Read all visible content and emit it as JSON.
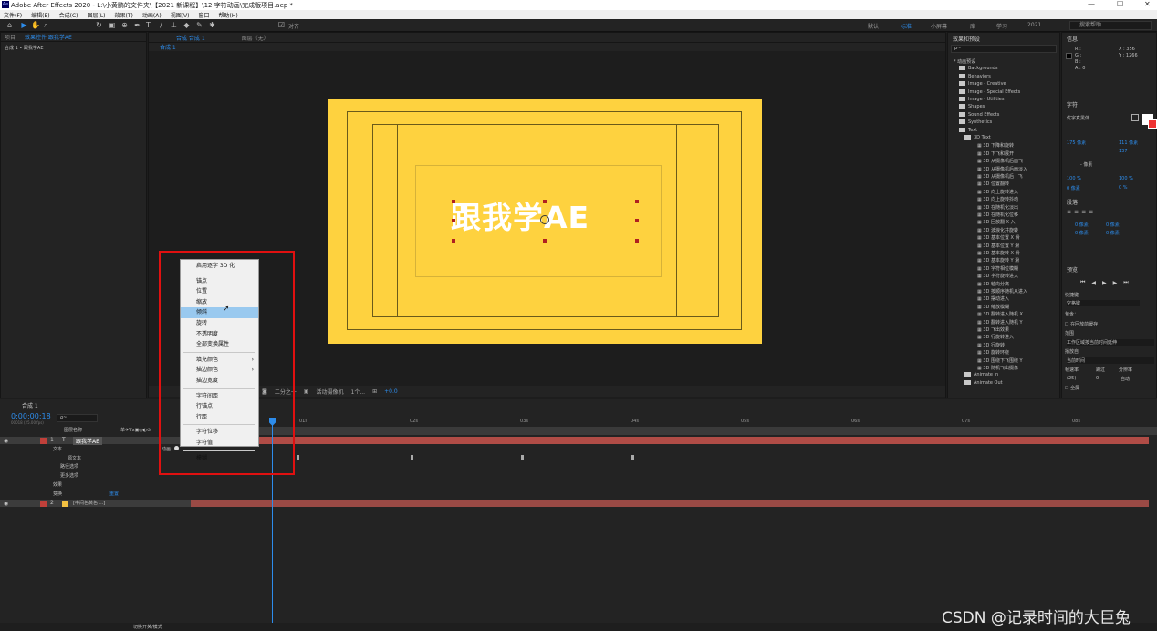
{
  "titlebar": {
    "title": "Adobe After Effects 2020 - L:\\小黄鹏的文件夹\\【2021 新课程】\\12 字符动画\\完成版项目.aep *",
    "minimize": "—",
    "maximize": "☐",
    "close": "✕"
  },
  "menu": [
    "文件(F)",
    "编辑(E)",
    "合成(C)",
    "图层(L)",
    "效果(T)",
    "动画(A)",
    "视图(V)",
    "窗口",
    "帮助(H)"
  ],
  "toolbar": {
    "snap_label": "对齐",
    "workspaces": [
      "默认",
      "标准",
      "小屏幕",
      "库",
      "学习",
      "2021"
    ],
    "active_workspace": "标准",
    "search_placeholder": "搜索帮助"
  },
  "left_panel": {
    "tabs": [
      "项目",
      "效果控件 跟我学AE"
    ],
    "breadcrumb": "合成 1 • 跟我学AE"
  },
  "comp_panel": {
    "tabs": [
      "合成 合成 1",
      "图层（无）"
    ],
    "sub_tab": "合成 1",
    "canvas_text": "跟我学AE",
    "viewer_bar": {
      "resolution": "二分之一",
      "camera": "活动摄像机",
      "views": "1个...",
      "exposure": "+0.0"
    }
  },
  "context_menu": {
    "items": [
      {
        "label": "启用逐字 3D 化",
        "sep_after": true
      },
      {
        "label": "锚点"
      },
      {
        "label": "位置"
      },
      {
        "label": "缩放"
      },
      {
        "label": "倾斜",
        "highlighted": true
      },
      {
        "label": "旋转"
      },
      {
        "label": "不透明度"
      },
      {
        "label": "全部变换属性",
        "sep_after": true
      },
      {
        "label": "填充颜色",
        "submenu": true
      },
      {
        "label": "描边颜色",
        "submenu": true
      },
      {
        "label": "描边宽度",
        "sep_after": true
      },
      {
        "label": "字符间距"
      },
      {
        "label": "行锚点"
      },
      {
        "label": "行距",
        "sep_after": true
      },
      {
        "label": "字符位移"
      },
      {
        "label": "字符值",
        "sep_after": true
      },
      {
        "label": "模糊"
      }
    ]
  },
  "effects_panel": {
    "title": "效果和预设",
    "search_placeholder": "ρ~",
    "items": [
      {
        "label": "* 动画预设",
        "level": 0
      },
      {
        "label": "Backgrounds",
        "level": 1,
        "folder": true
      },
      {
        "label": "Behaviors",
        "level": 1,
        "folder": true
      },
      {
        "label": "Image - Creative",
        "level": 1,
        "folder": true
      },
      {
        "label": "Image - Special Effects",
        "level": 1,
        "folder": true
      },
      {
        "label": "Image - Utilities",
        "level": 1,
        "folder": true
      },
      {
        "label": "Shapes",
        "level": 1,
        "folder": true
      },
      {
        "label": "Sound Effects",
        "level": 1,
        "folder": true
      },
      {
        "label": "Synthetics",
        "level": 1,
        "folder": true
      },
      {
        "label": "Text",
        "level": 1,
        "folder": true
      },
      {
        "label": "3D Text",
        "level": 2,
        "folder": true
      },
      {
        "label": "3D 下降和旋转",
        "level": 3
      },
      {
        "label": "3D 下飞和展开",
        "level": 3
      },
      {
        "label": "3D 从摄像机后面飞",
        "level": 3
      },
      {
        "label": "3D 从摄像机后面淡入",
        "level": 3
      },
      {
        "label": "3D 从摄像机后 I 飞",
        "level": 3
      },
      {
        "label": "3D 位置翻转",
        "level": 3
      },
      {
        "label": "3D 向上旋转进入",
        "level": 3
      },
      {
        "label": "3D 向上旋转抖动",
        "level": 3
      },
      {
        "label": "3D 在随机化淡出",
        "level": 3
      },
      {
        "label": "3D 在随机化位移",
        "level": 3
      },
      {
        "label": "3D 回放翻 X 入",
        "level": 3
      },
      {
        "label": "3D 波浪化并旋转",
        "level": 3
      },
      {
        "label": "3D 基本位置 X 滑",
        "level": 3
      },
      {
        "label": "3D 基本位置 Y 滑",
        "level": 3
      },
      {
        "label": "3D 基本旋转 X 滑",
        "level": 3
      },
      {
        "label": "3D 基本旋转 Y 滑",
        "level": 3
      },
      {
        "label": "3D 字符相位模糊",
        "level": 3
      },
      {
        "label": "3D 字符旋转进入",
        "level": 3
      },
      {
        "label": "3D 轴向分离",
        "level": 3
      },
      {
        "label": "3D 按顺序随机从进入",
        "level": 3
      },
      {
        "label": "3D 摆动进入",
        "level": 3
      },
      {
        "label": "3D 缩放模糊",
        "level": 3
      },
      {
        "label": "3D 翻转进入随机 X",
        "level": 3
      },
      {
        "label": "3D 翻转进入随机 Y",
        "level": 3
      },
      {
        "label": "3D 飞出效果",
        "level": 3
      },
      {
        "label": "3D 行旋转进入",
        "level": 3
      },
      {
        "label": "3D 行旋转",
        "level": 3
      },
      {
        "label": "3D 旋转环绕",
        "level": 3
      },
      {
        "label": "3D 围绕下飞围绕 Y",
        "level": 3
      },
      {
        "label": "3D 随机飞出摄像",
        "level": 3
      },
      {
        "label": "Animate In",
        "level": 2,
        "folder": true
      },
      {
        "label": "Animate Out",
        "level": 2,
        "folder": true
      }
    ]
  },
  "info_panel": {
    "title": "信息",
    "values": [
      "R :",
      "G :",
      "B :",
      "A : 0"
    ],
    "x": "X : 356",
    "y": "Y : 1266"
  },
  "character_panel": {
    "title": "字符",
    "font": "优字真黑体",
    "size": "175 像素",
    "leading": "111 像素",
    "tracking": "137",
    "stroke": "- 像素",
    "scale_v": "100 %",
    "scale_h": "100 %",
    "baseline": "0 像素",
    "tsume": "0 %"
  },
  "paragraph_panel": {
    "title": "段落",
    "indent_values": [
      "0 像素",
      "0 像素",
      "0 像素",
      "0 像素",
      "0 像素"
    ]
  },
  "preview_panel": {
    "title": "预览",
    "shortcut_label": "快捷键",
    "shortcut_value": "空格键",
    "include_label": "包含：",
    "cache_label": "在回放前缓存",
    "range_label": "范围",
    "range_value": "工作区域按当前时间延伸",
    "play_label": "播放自",
    "play_value": "当前时间",
    "fps_label": "帧速率",
    "skip_label": "跳过",
    "res_label": "分辨率",
    "fps_value": "(25)",
    "skip_value": "0",
    "res_value": "自动",
    "fullscreen_label": "全屏"
  },
  "timeline": {
    "tab": "合成 1",
    "timecode": "0:00:00:18",
    "fps_info": "00018 (25.00 fps)",
    "search_placeholder": "ρ~",
    "columns": {
      "source": "图层名称",
      "switches": "单✈\\fx▣◎◐⊙"
    },
    "rows": [
      {
        "num": "1",
        "name": "跟我学AE",
        "type": "T",
        "color": "#c0403a"
      },
      {
        "name": "文本"
      },
      {
        "name": "源文本"
      },
      {
        "name": "路径选项"
      },
      {
        "name": "更多选项"
      },
      {
        "name": "效果"
      },
      {
        "name": "变换",
        "extra": "重置"
      },
      {
        "num": "2",
        "name": "[中间色黄色 ...]",
        "type": "",
        "color": "#f3c142"
      }
    ],
    "animate_label": "动画：",
    "ruler": [
      "0s",
      "01s",
      "02s",
      "03s",
      "04s",
      "05s",
      "06s",
      "07s",
      "08s"
    ],
    "footer": "切换开关/模式"
  },
  "watermark": "CSDN @记录时间的大巨兔"
}
